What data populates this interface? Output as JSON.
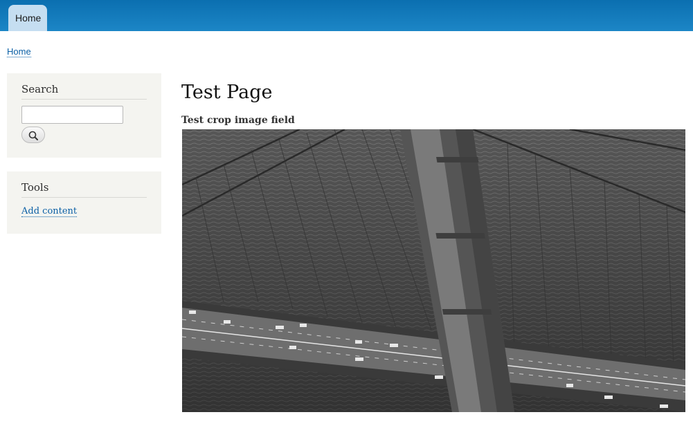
{
  "nav": {
    "tabs": [
      {
        "label": "Home"
      }
    ]
  },
  "breadcrumb": {
    "items": [
      {
        "label": "Home"
      }
    ]
  },
  "sidebar": {
    "search": {
      "title": "Search",
      "input_value": "",
      "button_icon": "search-icon"
    },
    "tools": {
      "title": "Tools",
      "links": [
        {
          "label": "Add content"
        }
      ]
    }
  },
  "main": {
    "title": "Test Page",
    "field_label": "Test crop image field"
  },
  "colors": {
    "header_bar": "#1a80c0",
    "active_tab": "#c5def1",
    "link": "#0a5fa5",
    "sidebar_block": "#f4f4f0"
  }
}
